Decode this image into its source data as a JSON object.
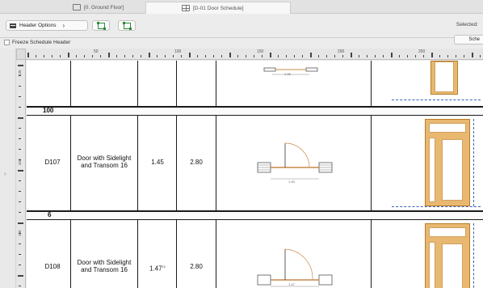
{
  "tabs": [
    {
      "label": "[0. Ground Floor]",
      "icon": "floor-plan-icon"
    },
    {
      "label": "[D-01 Door Schedule]",
      "icon": "schedule-icon"
    }
  ],
  "toolbar": {
    "header_options_label": "Header Options",
    "selected_label": "Selected:",
    "freeze_label": "Freeze Schedule Header",
    "sche_label": "Sche"
  },
  "ruler": {
    "top_labels": [
      "50",
      "100",
      "150",
      "200",
      "250"
    ],
    "left_labels": [
      "430",
      "450",
      "100"
    ]
  },
  "schedule": {
    "groups": [
      {
        "label": "100"
      },
      {
        "label": "6"
      }
    ],
    "rows": [
      {
        "id": "D107",
        "name": "Door with Sidelight and Transom 16",
        "width": "1.45",
        "height": "2.80",
        "plan_dim": "1.45"
      },
      {
        "id": "D108",
        "name": "Door with Sidelight and Transom 16",
        "width": "1.47",
        "width_mark": "†1",
        "height": "2.80",
        "plan_dim": "1.47"
      }
    ],
    "top_plan_dim": "1.05"
  },
  "colors": {
    "door_frame": "#e8b870",
    "dimension_line": "#3a63b8",
    "grid_line": "#1a1a1a"
  }
}
